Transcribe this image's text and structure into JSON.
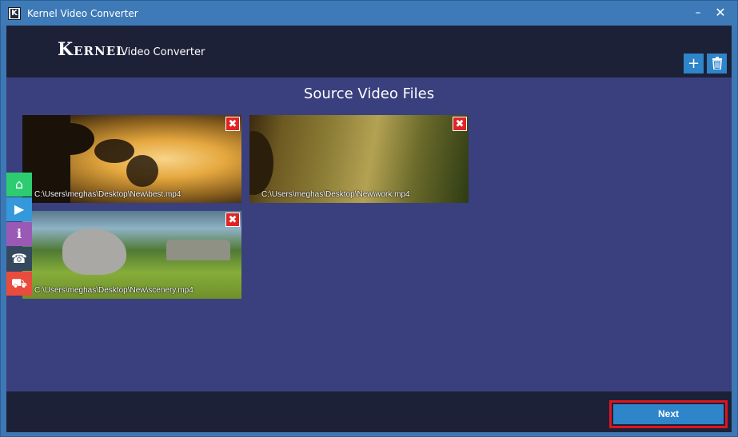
{
  "window": {
    "title": "Kernel Video Converter",
    "icon_letter": "K",
    "minimize_glyph": "–",
    "close_glyph": "✕"
  },
  "header": {
    "logo_main": "Kernel",
    "logo_sub": "Video Converter",
    "add_glyph": "+",
    "delete_glyph": "🗑"
  },
  "main": {
    "section_title": "Source Video Files",
    "files": [
      {
        "path": "C:\\Users\\meghas\\Desktop\\New\\best.mp4",
        "remove_glyph": "✖"
      },
      {
        "path": "C:\\Users\\meghas\\Desktop\\New\\work.mp4",
        "remove_glyph": "✖"
      },
      {
        "path": "C:\\Users\\meghas\\Desktop\\New\\scenery.mp4",
        "remove_glyph": "✖"
      }
    ]
  },
  "side_nav": {
    "home_glyph": "⌂",
    "video_glyph": "▶",
    "info_glyph": "i",
    "phone_glyph": "☎",
    "cart_glyph": "⛟"
  },
  "footer": {
    "next_label": "Next"
  },
  "colors": {
    "accent": "#2e85c9",
    "header_bg": "#1c2138",
    "main_bg": "#3a3f7e",
    "highlight": "#e0141e",
    "remove": "#e02424"
  }
}
